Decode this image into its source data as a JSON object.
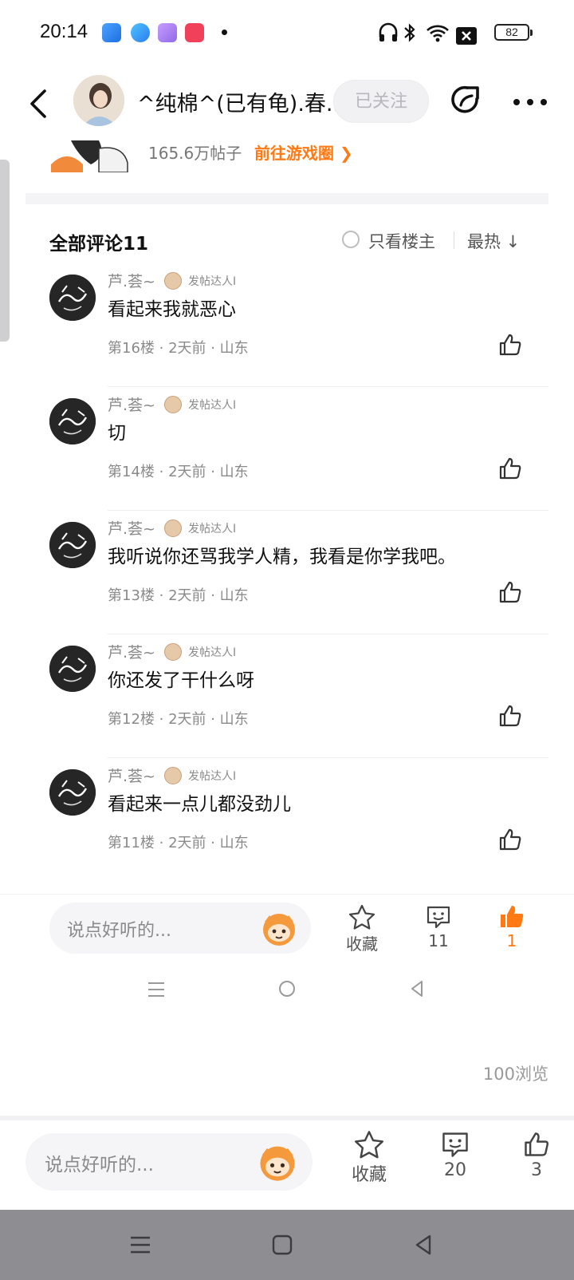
{
  "status_bar": {
    "time": "20:14",
    "battery": "82",
    "icons": [
      "headphones-icon",
      "bluetooth-icon",
      "wifi-icon",
      "sim-blocked-icon"
    ]
  },
  "header": {
    "title": "^纯棉^(已有龟).春...",
    "follow_label": "已关注"
  },
  "forum": {
    "post_count": "165.6万帖子",
    "link_label": "前往游戏圈 ❯"
  },
  "comments_header": {
    "title": "全部评论11",
    "owner_only_label": "只看楼主",
    "sort_label": "最热 ↓"
  },
  "comments": [
    {
      "author": "芦.荟~",
      "badge": "发帖达人I",
      "text": "看起来我就恶心",
      "meta": "第16楼 · 2天前 · 山东"
    },
    {
      "author": "芦.荟~",
      "badge": "发帖达人I",
      "text": "切",
      "meta": "第14楼 · 2天前 · 山东"
    },
    {
      "author": "芦.荟~",
      "badge": "发帖达人I",
      "text": "我听说你还骂我学人精，我看是你学我吧。",
      "meta": "第13楼 · 2天前 · 山东"
    },
    {
      "author": "芦.荟~",
      "badge": "发帖达人I",
      "text": "你还发了干什么呀",
      "meta": "第12楼 · 2天前 · 山东"
    },
    {
      "author": "芦.荟~",
      "badge": "发帖达人I",
      "text": "看起来一点儿都没劲儿",
      "meta": "第11楼 · 2天前 · 山东"
    }
  ],
  "inner_bar": {
    "placeholder": "说点好听的...",
    "favorite_label": "收藏",
    "comment_count": "11",
    "like_count": "1"
  },
  "view_count": "100浏览",
  "outer_bar": {
    "placeholder": "说点好听的...",
    "favorite_label": "收藏",
    "comment_count": "20",
    "like_count": "3"
  },
  "colors": {
    "accent": "#ff7a14",
    "like_active": "#ff7a14",
    "text_primary": "#111111",
    "text_secondary": "#8a8a8a"
  }
}
